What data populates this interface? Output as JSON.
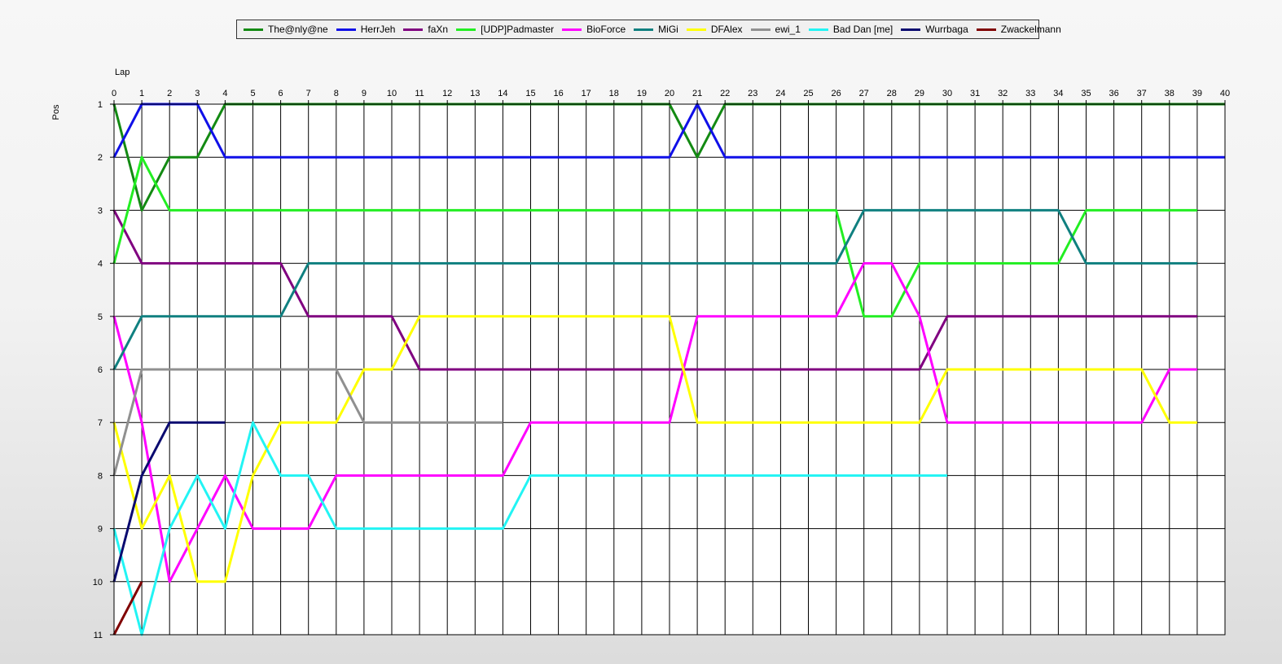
{
  "chart_data": {
    "type": "line",
    "xlabel": "Lap",
    "ylabel": "Pos",
    "xlim": [
      0,
      40
    ],
    "ylim": [
      1,
      11
    ],
    "y_inverted": true,
    "grid": true,
    "legend_position": "top",
    "x_ticks": [
      0,
      1,
      2,
      3,
      4,
      5,
      6,
      7,
      8,
      9,
      10,
      11,
      12,
      13,
      14,
      15,
      16,
      17,
      18,
      19,
      20,
      21,
      22,
      23,
      24,
      25,
      26,
      27,
      28,
      29,
      30,
      31,
      32,
      33,
      34,
      35,
      36,
      37,
      38,
      39,
      40
    ],
    "y_ticks": [
      1,
      2,
      3,
      4,
      5,
      6,
      7,
      8,
      9,
      10,
      11
    ],
    "series": [
      {
        "name": "The@nly@ne",
        "color": "#138a13",
        "x": [
          0,
          1,
          2,
          3,
          4,
          5,
          6,
          7,
          8,
          9,
          10,
          11,
          12,
          13,
          14,
          15,
          16,
          17,
          18,
          19,
          20,
          21,
          22,
          23,
          24,
          25,
          26,
          27,
          28,
          29,
          30,
          31,
          32,
          33,
          34,
          35,
          36,
          37,
          38,
          39,
          40
        ],
        "y": [
          1,
          3,
          2,
          2,
          1,
          1,
          1,
          1,
          1,
          1,
          1,
          1,
          1,
          1,
          1,
          1,
          1,
          1,
          1,
          1,
          1,
          2,
          1,
          1,
          1,
          1,
          1,
          1,
          1,
          1,
          1,
          1,
          1,
          1,
          1,
          1,
          1,
          1,
          1,
          1,
          1
        ]
      },
      {
        "name": "HerrJeh",
        "color": "#1010e8",
        "x": [
          0,
          1,
          2,
          3,
          4,
          5,
          6,
          7,
          8,
          9,
          10,
          11,
          12,
          13,
          14,
          15,
          16,
          17,
          18,
          19,
          20,
          21,
          22,
          23,
          24,
          25,
          26,
          27,
          28,
          29,
          30,
          31,
          32,
          33,
          34,
          35,
          36,
          37,
          38,
          39,
          40
        ],
        "y": [
          2,
          1,
          1,
          1,
          2,
          2,
          2,
          2,
          2,
          2,
          2,
          2,
          2,
          2,
          2,
          2,
          2,
          2,
          2,
          2,
          2,
          1,
          2,
          2,
          2,
          2,
          2,
          2,
          2,
          2,
          2,
          2,
          2,
          2,
          2,
          2,
          2,
          2,
          2,
          2,
          2
        ]
      },
      {
        "name": "faXn",
        "color": "#800080",
        "x": [
          0,
          1,
          2,
          3,
          4,
          5,
          6,
          7,
          8,
          9,
          10,
          11,
          12,
          13,
          14,
          15,
          16,
          17,
          18,
          19,
          20,
          21,
          22,
          23,
          24,
          25,
          26,
          27,
          28,
          29,
          30,
          31,
          32,
          33,
          34,
          35,
          36,
          37,
          38,
          39
        ],
        "y": [
          3,
          4,
          4,
          4,
          4,
          4,
          4,
          5,
          5,
          5,
          5,
          6,
          6,
          6,
          6,
          6,
          6,
          6,
          6,
          6,
          6,
          6,
          6,
          6,
          6,
          6,
          6,
          6,
          6,
          6,
          5,
          5,
          5,
          5,
          5,
          5,
          5,
          5,
          5,
          5
        ]
      },
      {
        "name": "[UDP]Padmaster",
        "color": "#22ee22",
        "x": [
          0,
          1,
          2,
          3,
          4,
          5,
          6,
          7,
          8,
          9,
          10,
          11,
          12,
          13,
          14,
          15,
          16,
          17,
          18,
          19,
          20,
          21,
          22,
          23,
          24,
          25,
          26,
          27,
          28,
          29,
          30,
          31,
          32,
          33,
          34,
          35,
          36,
          37,
          38,
          39
        ],
        "y": [
          4,
          2,
          3,
          3,
          3,
          3,
          3,
          3,
          3,
          3,
          3,
          3,
          3,
          3,
          3,
          3,
          3,
          3,
          3,
          3,
          3,
          3,
          3,
          3,
          3,
          3,
          3,
          5,
          5,
          4,
          4,
          4,
          4,
          4,
          4,
          3,
          3,
          3,
          3,
          3
        ]
      },
      {
        "name": "BioForce",
        "color": "#ff00ff",
        "x": [
          0,
          1,
          2,
          3,
          4,
          5,
          6,
          7,
          8,
          9,
          10,
          11,
          12,
          13,
          14,
          15,
          16,
          17,
          18,
          19,
          20,
          21,
          22,
          23,
          24,
          25,
          26,
          27,
          28,
          29,
          30,
          31,
          32,
          33,
          34,
          35,
          36,
          37,
          38,
          39
        ],
        "y": [
          5,
          7,
          10,
          9,
          8,
          9,
          9,
          9,
          8,
          8,
          8,
          8,
          8,
          8,
          8,
          7,
          7,
          7,
          7,
          7,
          7,
          5,
          5,
          5,
          5,
          5,
          5,
          4,
          4,
          5,
          7,
          7,
          7,
          7,
          7,
          7,
          7,
          7,
          6,
          6
        ]
      },
      {
        "name": "MiGi",
        "color": "#108080",
        "x": [
          0,
          1,
          2,
          3,
          4,
          5,
          6,
          7,
          8,
          9,
          10,
          11,
          12,
          13,
          14,
          15,
          16,
          17,
          18,
          19,
          20,
          21,
          22,
          23,
          24,
          25,
          26,
          27,
          28,
          29,
          30,
          31,
          32,
          33,
          34,
          35,
          36,
          37,
          38,
          39
        ],
        "y": [
          6,
          5,
          5,
          5,
          5,
          5,
          5,
          4,
          4,
          4,
          4,
          4,
          4,
          4,
          4,
          4,
          4,
          4,
          4,
          4,
          4,
          4,
          4,
          4,
          4,
          4,
          4,
          3,
          3,
          3,
          3,
          3,
          3,
          3,
          3,
          4,
          4,
          4,
          4,
          4
        ]
      },
      {
        "name": "DFAlex",
        "color": "#ffff00",
        "x": [
          0,
          1,
          2,
          3,
          4,
          5,
          6,
          7,
          8,
          9,
          10,
          11,
          12,
          13,
          14,
          15,
          16,
          17,
          18,
          19,
          20,
          21,
          22,
          23,
          24,
          25,
          26,
          27,
          28,
          29,
          30,
          31,
          32,
          33,
          34,
          35,
          36,
          37,
          38,
          39
        ],
        "y": [
          7,
          9,
          8,
          10,
          10,
          8,
          7,
          7,
          7,
          6,
          6,
          5,
          5,
          5,
          5,
          5,
          5,
          5,
          5,
          5,
          5,
          7,
          7,
          7,
          7,
          7,
          7,
          7,
          7,
          7,
          6,
          6,
          6,
          6,
          6,
          6,
          6,
          6,
          7,
          7
        ]
      },
      {
        "name": "ewi_1",
        "color": "#909090",
        "x": [
          0,
          1,
          2,
          3,
          4,
          5,
          6,
          7,
          8,
          9,
          10,
          11,
          12,
          13,
          14
        ],
        "y": [
          8,
          6,
          6,
          6,
          6,
          6,
          6,
          6,
          6,
          7,
          7,
          7,
          7,
          7,
          7
        ]
      },
      {
        "name": "Bad Dan [me]",
        "color": "#22f4f4",
        "x": [
          0,
          1,
          2,
          3,
          4,
          5,
          6,
          7,
          8,
          9,
          10,
          11,
          12,
          13,
          14,
          15,
          16,
          17,
          18,
          19,
          20,
          21,
          22,
          23,
          24,
          25,
          26,
          27,
          28,
          29,
          30
        ],
        "y": [
          9,
          11,
          9,
          8,
          9,
          7,
          8,
          8,
          9,
          9,
          9,
          9,
          9,
          9,
          9,
          8,
          8,
          8,
          8,
          8,
          8,
          8,
          8,
          8,
          8,
          8,
          8,
          8,
          8,
          8,
          8
        ]
      },
      {
        "name": "Wurrbaga",
        "color": "#0a0a70",
        "x": [
          0,
          1,
          2,
          3,
          4
        ],
        "y": [
          10,
          8,
          7,
          7,
          7
        ]
      },
      {
        "name": "Zwackelmann",
        "color": "#800000",
        "x": [
          0,
          1
        ],
        "y": [
          11,
          10
        ]
      }
    ]
  }
}
